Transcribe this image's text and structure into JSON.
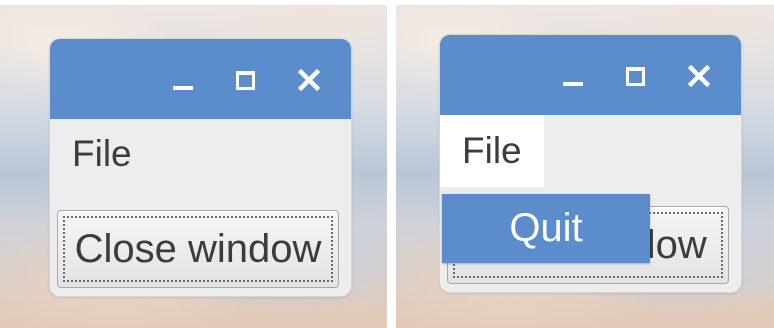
{
  "left_panel": {
    "menu": {
      "file_label": "File"
    },
    "button": {
      "label": "Close window"
    }
  },
  "right_panel": {
    "menu": {
      "file_label": "File"
    },
    "button": {
      "label": "Close window"
    },
    "dropdown": {
      "items": [
        {
          "label": "Quit"
        }
      ]
    }
  },
  "icons": {
    "minimize": "minimize-icon",
    "maximize": "maximize-icon",
    "close": "close-icon"
  },
  "colors": {
    "accent": "#5b8ccc",
    "window_bg": "#ededed",
    "text": "#3c3c3c"
  }
}
